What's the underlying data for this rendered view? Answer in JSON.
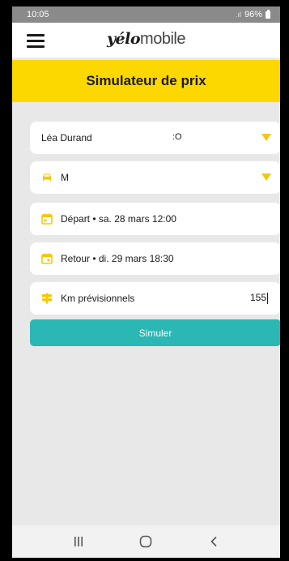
{
  "status": {
    "time": "10:05",
    "battery": "96%"
  },
  "app": {
    "logo_bold": "yélo",
    "logo_light": "mobile"
  },
  "title": "Simulateur de prix",
  "fields": {
    "user": {
      "label": "Léa Durand",
      "extra": ":O"
    },
    "vehicle": {
      "label": "M",
      "icon": "car-icon"
    },
    "departure": {
      "label": "Départ • sa. 28 mars 12:00",
      "icon": "calendar-icon"
    },
    "return": {
      "label": "Retour • di. 29 mars 18:30",
      "icon": "calendar-icon"
    },
    "km": {
      "label": "Km prévisionnels",
      "value": "155",
      "icon": "signpost-icon"
    }
  },
  "simulate_label": "Simuler",
  "colors": {
    "accent_yellow": "#fcd800",
    "teal": "#2bb7b3",
    "background": "#e8e8e8"
  }
}
